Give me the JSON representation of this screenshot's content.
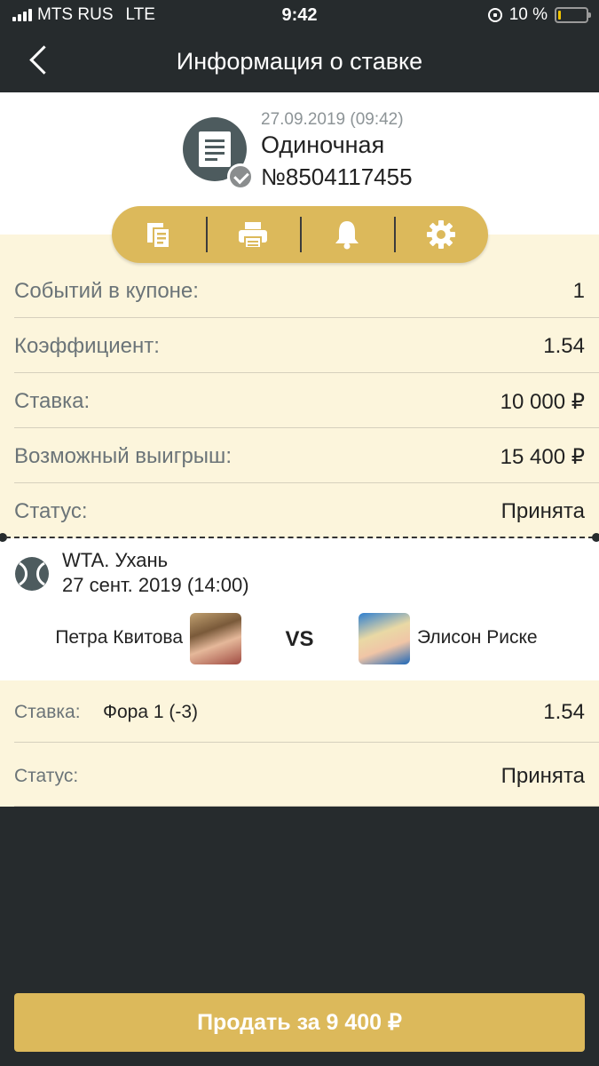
{
  "status_bar": {
    "carrier": "MTS RUS",
    "network": "LTE",
    "time": "9:42",
    "battery": "10 %",
    "battery_level_percent": 10,
    "battery_color": "#f0c400"
  },
  "navbar": {
    "title": "Информация о ставке",
    "back_icon": "chevron-left-icon"
  },
  "bet": {
    "date": "27.09.2019 (09:42)",
    "type": "Одиночная",
    "number": "№8504117455",
    "icon": "receipt-icon",
    "badge_icon": "check-icon"
  },
  "actions": [
    {
      "icon": "copy-icon"
    },
    {
      "icon": "print-icon"
    },
    {
      "icon": "bell-icon"
    },
    {
      "icon": "gear-icon"
    }
  ],
  "summary": [
    {
      "label": "Событий в купоне:",
      "value": "1"
    },
    {
      "label": "Коэффициент:",
      "value": "1.54"
    },
    {
      "label": "Ставка:",
      "value": "10 000 ₽"
    },
    {
      "label": "Возможный выигрыш:",
      "value": "15 400 ₽"
    },
    {
      "label": "Статус:",
      "value": "Принята"
    }
  ],
  "event": {
    "icon": "tennis-ball-icon",
    "tournament": "WTA. Ухань",
    "date": "27 сент. 2019 (14:00)",
    "player1": "Петра Квитова",
    "vs": "VS",
    "player2": "Элисон Риске"
  },
  "details": {
    "stake_label": "Ставка:",
    "outcome": "Фора 1 (-3)",
    "odds": "1.54",
    "status_label": "Статус:",
    "status": "Принята"
  },
  "sell_button": "Продать за 9 400 ₽",
  "colors": {
    "accent": "#dcb95b",
    "dark": "#262b2d",
    "panel": "#fcf5dc"
  }
}
